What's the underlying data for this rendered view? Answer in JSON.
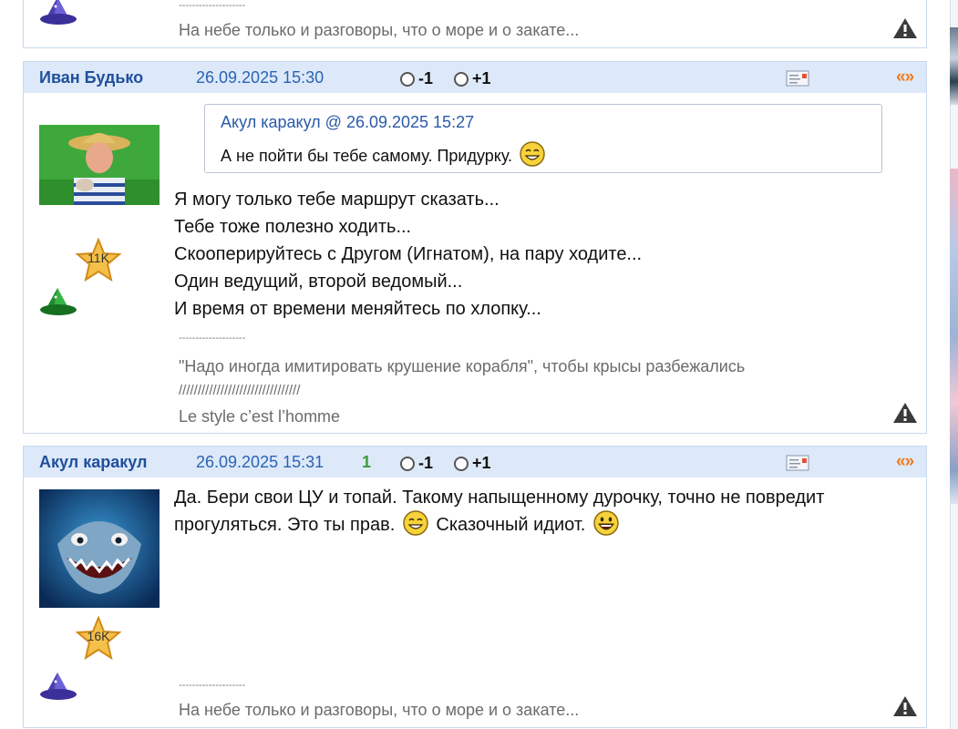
{
  "posts": [
    {
      "signature": "На небе только и разговоры, что о море и о закате...",
      "sig_sep": "--------------------"
    },
    {
      "author": "Иван Будько",
      "date": "26.09.2025 15:30",
      "vote_minus": "-1",
      "vote_plus": "+1",
      "quote_link": "«»",
      "avatar_desc": "man-in-straw-hat",
      "rating_star": "11K",
      "quote": {
        "head": "Акул каракул @ 26.09.2025 15:27",
        "text": "А не пойти бы тебе самому. Придурку."
      },
      "lines": [
        "Я могу только тебе маршрут сказать...",
        "Тебе тоже полезно ходить...",
        "Скооперируйтесь с Другом (Игнатом), на пару ходите...",
        "Один ведущий, второй ведомый...",
        "И время от времени меняйтесь по хлопку..."
      ],
      "sig_sep": "--------------------",
      "signature_lines": [
        "\"Надо иногда имитировать крушение корабля\", чтобы крысы разбежались",
        "////////////////////////////////",
        "Le style c’est l’homme"
      ]
    },
    {
      "author": "Акул каракул",
      "date": "26.09.2025 15:31",
      "rating": "1",
      "vote_minus": "-1",
      "vote_plus": "+1",
      "quote_link": "«»",
      "rating_star": "16K",
      "text_line1": "Да. Бери свои ЦУ и топай. Такому напыщенному дурочку, точно не повредит",
      "text_line2a": "прогуляться. Это ты прав.",
      "text_line2b": "Сказочный идиот.",
      "sig_sep": "--------------------",
      "signature": "На небе только и разговоры, что о море и о закате..."
    }
  ],
  "colors": {
    "header_bg": "#dde9f8",
    "author": "#1f4f9e",
    "date": "#2b63b7",
    "rating_positive": "#3a9c3a",
    "quote_link": "#f07a1c"
  },
  "icons": [
    "wizard-hat-icon",
    "message-icon",
    "warning-icon",
    "star-badge-icon",
    "smiley-icon",
    "laugh-icon"
  ]
}
